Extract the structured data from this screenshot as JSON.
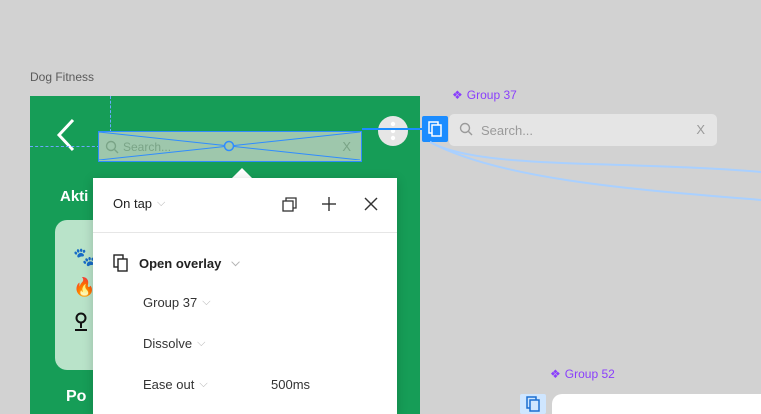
{
  "canvas": {
    "frame_label": "Dog Fitness",
    "component_label": "Group 37",
    "component_label_2": "Group 52"
  },
  "phone": {
    "section_title": "Akti",
    "bottom_title": "Po",
    "search_placeholder": "Search...",
    "search_clear": "X",
    "card_icons": [
      "paw-icon",
      "flame-icon",
      "location-pin-icon"
    ]
  },
  "overlay_component": {
    "search_placeholder": "Search...",
    "clear_label": "X"
  },
  "interaction_panel": {
    "trigger": "On tap",
    "action": "Open overlay",
    "destination": "Group 37",
    "animation": "Dissolve",
    "easing": "Ease out",
    "duration": "500ms"
  },
  "colors": {
    "canvas": "#d2d2d2",
    "frame_green": "#169d57",
    "selection_blue": "#1b8cff",
    "component_purple": "#8a3ffc"
  }
}
